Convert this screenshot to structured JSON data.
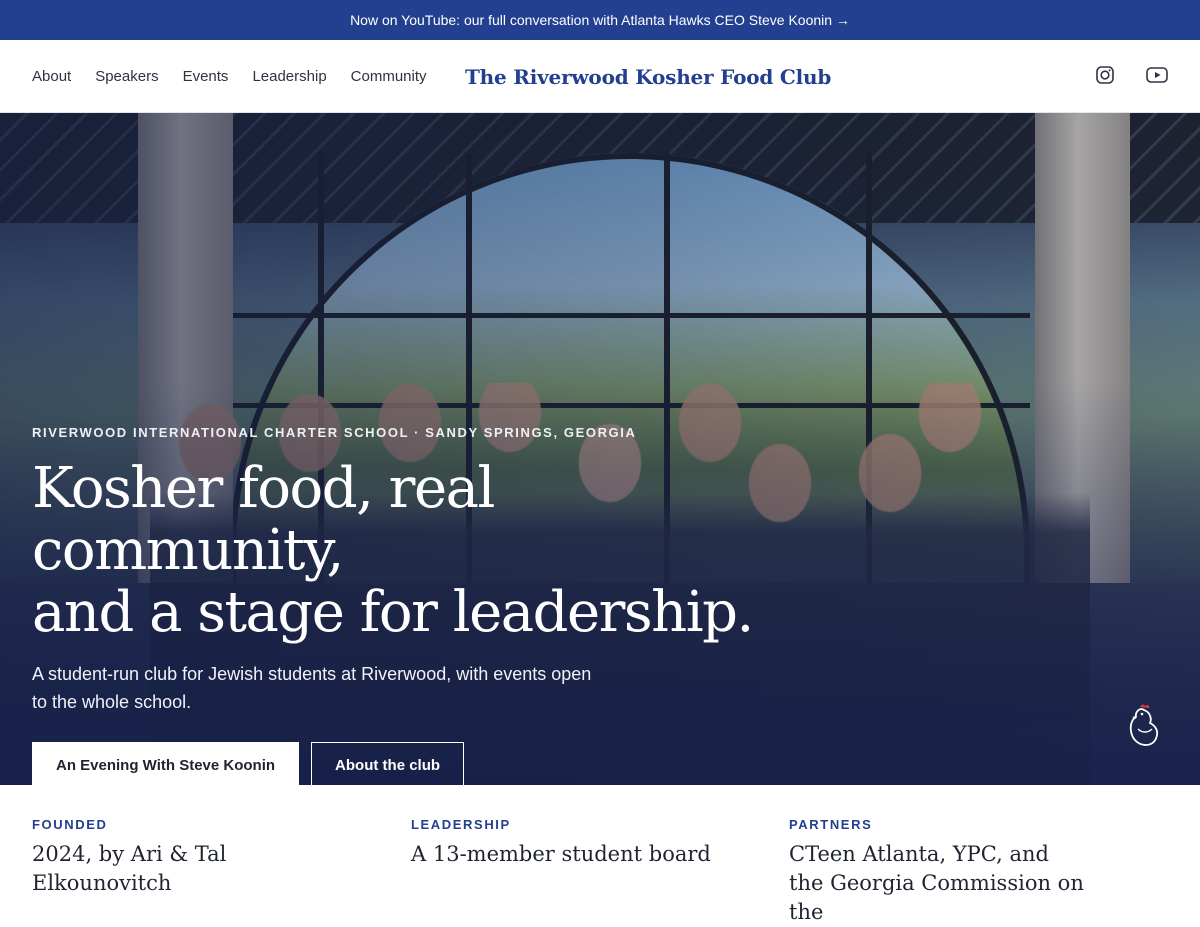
{
  "announcement": {
    "text": "Now on YouTube: our full conversation with Atlanta Hawks CEO Steve Koonin →"
  },
  "nav": {
    "links": [
      "About",
      "Speakers",
      "Events",
      "Leadership",
      "Community"
    ],
    "brand": "The Riverwood Kosher Food Club",
    "social": [
      "instagram-icon",
      "youtube-icon"
    ]
  },
  "hero": {
    "eyebrow": "RIVERWOOD INTERNATIONAL CHARTER SCHOOL · SANDY SPRINGS, GEORGIA",
    "headline_line1": "Kosher food, real community,",
    "headline_line2": "and a stage for leadership.",
    "subtext": "A student-run club for Jewish students at Riverwood, with events open to the whole school.",
    "primary_cta": "An Evening With Steve Koonin",
    "secondary_cta": "About the club"
  },
  "facts": [
    {
      "label": "FOUNDED",
      "value": "2024, by Ari & Tal Elkounovitch"
    },
    {
      "label": "LEADERSHIP",
      "value": "A 13-member student board"
    },
    {
      "label": "PARTNERS",
      "value": "CTeen Atlanta, YPC, and the Georgia Commission on the"
    }
  ],
  "colors": {
    "brand_blue": "#22408f",
    "white": "#ffffff"
  }
}
